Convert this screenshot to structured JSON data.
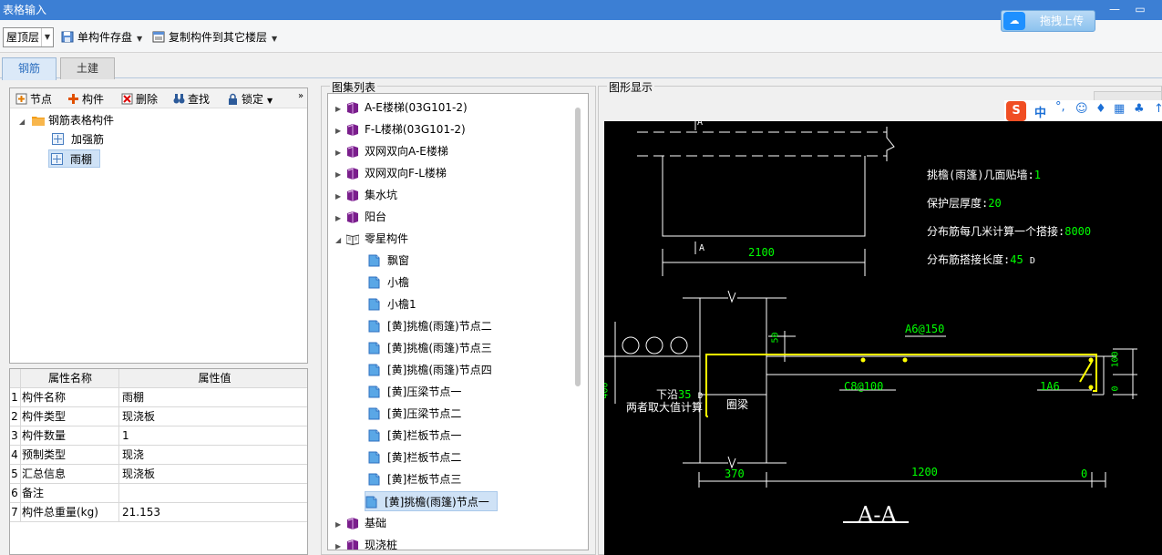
{
  "window": {
    "title": "表格输入",
    "min": "—",
    "restore": "▭"
  },
  "toolbar": {
    "floor": "屋顶层",
    "save_single": "单构件存盘",
    "copy_floor": "复制构件到其它楼层",
    "upload": "拖拽上传"
  },
  "tabs": [
    {
      "label": "钢筋",
      "active": true
    },
    {
      "label": "土建",
      "active": false
    }
  ],
  "left_toolbar": {
    "node": "节点",
    "component": "构件",
    "delete": "删除",
    "find": "查找",
    "lock": "锁定"
  },
  "tree": {
    "root": "钢筋表格构件",
    "children": [
      "加强筋",
      "雨棚"
    ],
    "selected": "雨棚"
  },
  "properties": {
    "headers": [
      "属性名称",
      "属性值"
    ],
    "rows": [
      {
        "n": "1",
        "name": "构件名称",
        "value": "雨棚"
      },
      {
        "n": "2",
        "name": "构件类型",
        "value": "现浇板"
      },
      {
        "n": "3",
        "name": "构件数量",
        "value": "1"
      },
      {
        "n": "4",
        "name": "预制类型",
        "value": "现浇"
      },
      {
        "n": "5",
        "name": "汇总信息",
        "value": "现浇板"
      },
      {
        "n": "6",
        "name": "备注",
        "value": ""
      },
      {
        "n": "7",
        "name": "构件总重量(kg)",
        "value": "21.153"
      }
    ]
  },
  "atlas": {
    "title": "图集列表",
    "items": [
      {
        "label": "A-E楼梯(03G101-2)",
        "kind": "book"
      },
      {
        "label": "F-L楼梯(03G101-2)",
        "kind": "book"
      },
      {
        "label": "双网双向A-E楼梯",
        "kind": "book"
      },
      {
        "label": "双网双向F-L楼梯",
        "kind": "book"
      },
      {
        "label": "集水坑",
        "kind": "book"
      },
      {
        "label": "阳台",
        "kind": "book"
      },
      {
        "label": "零星构件",
        "kind": "open"
      },
      {
        "label": "飘窗",
        "kind": "page"
      },
      {
        "label": "小檐",
        "kind": "page"
      },
      {
        "label": "小檐1",
        "kind": "page"
      },
      {
        "label": "[黄]挑檐(雨篷)节点二",
        "kind": "page"
      },
      {
        "label": "[黄]挑檐(雨篷)节点三",
        "kind": "page"
      },
      {
        "label": "[黄]挑檐(雨篷)节点四",
        "kind": "page"
      },
      {
        "label": "[黄]压梁节点一",
        "kind": "page"
      },
      {
        "label": "[黄]压梁节点二",
        "kind": "page"
      },
      {
        "label": "[黄]栏板节点一",
        "kind": "page"
      },
      {
        "label": "[黄]栏板节点二",
        "kind": "page"
      },
      {
        "label": "[黄]栏板节点三",
        "kind": "page"
      },
      {
        "label": "[黄]挑檐(雨篷)节点一",
        "kind": "page",
        "selected": true
      },
      {
        "label": "基础",
        "kind": "book"
      },
      {
        "label": "现浇桩",
        "kind": "book"
      }
    ]
  },
  "graphic": {
    "title": "图形显示",
    "params": [
      {
        "label": "挑檐(雨篷)几面贴墙:",
        "value": "1"
      },
      {
        "label": "保护层厚度:",
        "value": "20"
      },
      {
        "label": "分布筋每几米计算一个搭接:",
        "value": "8000"
      },
      {
        "label": "分布筋搭接长度:",
        "value": "45",
        "suffix": "D"
      }
    ],
    "section_mark": "A",
    "dim_2100": "2100",
    "dim_50": "50",
    "dim_400": "400",
    "rebar_top": "A6@150",
    "rebar_dist": "C8@100",
    "rebar_end": "1A6",
    "anchor_label": "下沿",
    "anchor_value": "35",
    "anchor_unit": "D",
    "anchor_note": "两者取大值计算",
    "beam_label": "圈梁",
    "dim_100": "100",
    "dim_0_right": "0",
    "dim_370": "370",
    "dim_1200": "1200",
    "dim_0": "0",
    "section_title": "A-A"
  },
  "colors": {
    "titlebar": "#3c7fd4",
    "cad_bg": "#000000",
    "cad_green": "#00ff00",
    "cad_yellow": "#ffff00",
    "cad_white": "#ffffff",
    "book": "#7a1e8c"
  }
}
